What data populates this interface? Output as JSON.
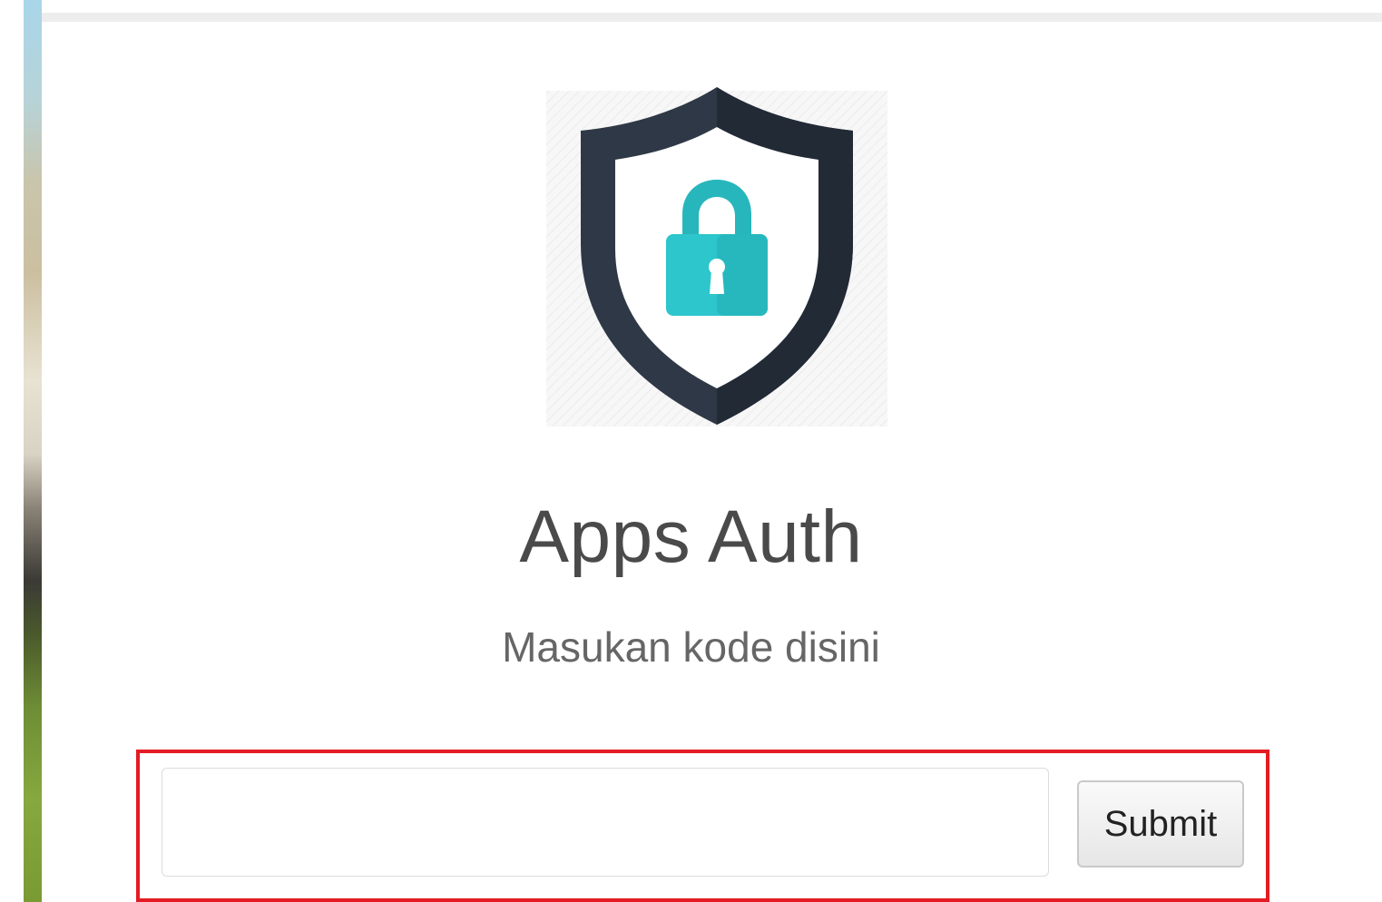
{
  "app": {
    "title": "Apps Auth",
    "subtitle": "Masukan kode disini"
  },
  "form": {
    "code_value": "",
    "code_placeholder": "",
    "submit_label": "Submit"
  },
  "icons": {
    "logo": "shield-lock-icon"
  },
  "colors": {
    "shield": "#2f3846",
    "lock": "#2cc6cc",
    "highlight": "#e31b23",
    "title_text": "#4a4a4a"
  }
}
